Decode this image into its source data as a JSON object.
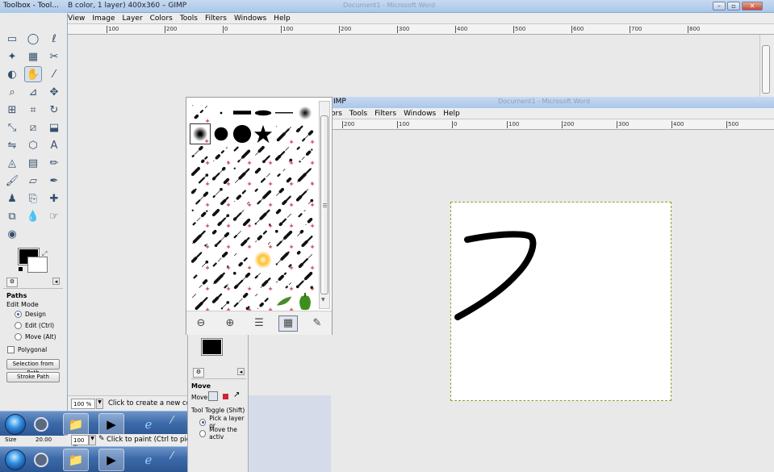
{
  "bg_window": {
    "title": "Toolbox - Tool...",
    "title_rest": "B color, 1 layer) 400x360 – GIMP",
    "faint_title": "Document1 - Microsoft Word",
    "menu": [
      "View",
      "Image",
      "Layer",
      "Colors",
      "Tools",
      "Filters",
      "Windows",
      "Help"
    ],
    "ruler": [
      "|100",
      "|200",
      "0",
      "|100",
      "|200",
      "|300",
      "|400",
      "|500",
      "|600",
      "|700",
      "|800"
    ],
    "status_zoom": "100 %",
    "status_text": "Click to create a new com"
  },
  "toolbox": {
    "title": "Toolbox - Tool...",
    "tools": [
      "rect-select",
      "ellipse-select",
      "free-select",
      "fuzzy-select",
      "by-color-select",
      "scissors",
      "foreground-select",
      "paths",
      "color-picker",
      "zoom",
      "measure",
      "move",
      "align",
      "crop",
      "rotate",
      "scale",
      "shear",
      "perspective",
      "flip",
      "cage",
      "text",
      "bucket-fill",
      "blend",
      "pencil",
      "paintbrush",
      "eraser",
      "airbrush",
      "ink",
      "clone",
      "heal",
      "perspective-clone",
      "blur",
      "smudge",
      "dodge-burn"
    ],
    "fg_color": "#000000",
    "bg_color": "#ffffff",
    "opts_title": "Paths",
    "edit_mode_label": "Edit Mode",
    "modes": [
      "Design",
      "Edit (Ctrl)",
      "Move (Alt)"
    ],
    "polygonal_label": "Polygonal",
    "selection_from_path": "Selection from Path",
    "stroke_path": "Stroke Path",
    "size_label": "Size",
    "size_value": "20.00"
  },
  "win2": {
    "menu": [
      "ors",
      "Tools",
      "Filters",
      "Windows",
      "Help"
    ],
    "title_frag": "IMP",
    "faint_title": "Document1 - Microsoft Word",
    "ruler": [
      "|200",
      "|100",
      "0",
      "|100",
      "|200",
      "|300",
      "|400",
      "|500"
    ],
    "status_zoom": "100 %",
    "status_text": "Click to paint (Ctrl to pick a"
  },
  "tb2": {
    "opts_title": "Move",
    "move_label": "Move:",
    "tool_toggle": "Tool Toggle  (Shift)",
    "opt1": "Pick a layer or",
    "opt2": "Move the activ"
  },
  "brushes": {
    "tools": [
      "zoom-out",
      "zoom-in",
      "list-view",
      "grid-view",
      "edit-brush"
    ]
  },
  "taskbar": {
    "items": [
      "windows-explorer",
      "media-player",
      "internet-explorer",
      "other"
    ]
  }
}
